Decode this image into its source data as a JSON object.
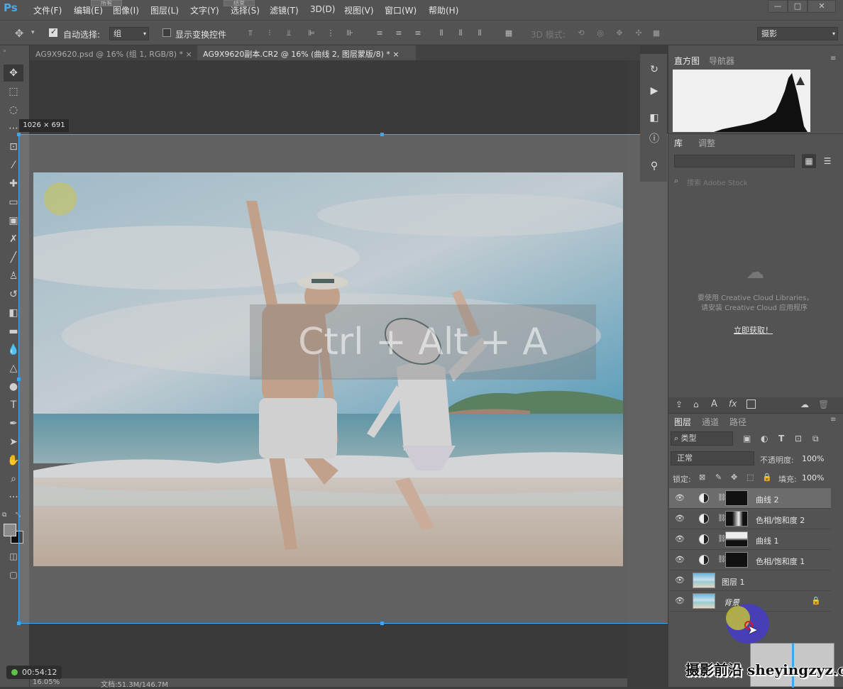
{
  "menubar": {
    "logo": "Ps",
    "items": [
      "文件(F)",
      "编辑(E)",
      "图像(I)",
      "图层(L)",
      "文字(Y)",
      "选择(S)",
      "滤镜(T)",
      "3D(D)",
      "视图(V)",
      "窗口(W)",
      "帮助(H)"
    ],
    "faded_buttons": [
      "所有",
      "",
      "",
      "",
      "结束"
    ]
  },
  "options": {
    "auto_select_label": "自动选择:",
    "auto_select_value": "组",
    "show_transform_label": "显示变换控件",
    "mode_3d": "3D 模式:",
    "workspace": "摄影"
  },
  "tabs": [
    {
      "label": "AG9X9620.psd @ 16% (组 1, RGB/8) *",
      "close": "×"
    },
    {
      "label": "AG9X9620副本.CR2 @ 16% (曲线 2, 图层蒙版/8) *",
      "close": "×"
    }
  ],
  "canvas": {
    "dimensions": "1026 × 691",
    "shortcut": "Ctrl + Alt + A",
    "zoom": "16.05%",
    "doc_size": "文档:51.3M/146.7M"
  },
  "recorder": {
    "time": "00:54:12"
  },
  "histogram_panel": {
    "tabs": [
      "直方图",
      "导航器"
    ]
  },
  "library_panel": {
    "tabs": [
      "库",
      "调整"
    ],
    "search_placeholder": "搜索 Adobe Stock",
    "cc_line1": "要使用 Creative Cloud Libraries，",
    "cc_line2": "请安装 Creative Cloud 应用程序",
    "get_now": "立即获取！"
  },
  "layers_panel": {
    "tabs": [
      "图层",
      "通道",
      "路径"
    ],
    "filter_type": "类型",
    "blend_mode": "正常",
    "opacity_label": "不透明度:",
    "opacity_value": "100%",
    "lock_label": "锁定:",
    "fill_label": "填充:",
    "fill_value": "100%",
    "layers": [
      {
        "name": "曲线 2",
        "selected": true,
        "kind": "adjustment"
      },
      {
        "name": "色相/饱和度 2",
        "selected": false,
        "kind": "adjustment"
      },
      {
        "name": "曲线 1",
        "selected": false,
        "kind": "adjustment"
      },
      {
        "name": "色相/饱和度 1",
        "selected": false,
        "kind": "adjustment"
      },
      {
        "name": "图层 1",
        "selected": false,
        "kind": "pixel"
      },
      {
        "name": "背景",
        "selected": false,
        "kind": "background"
      }
    ]
  },
  "watermark": "摄影前沿 sheyingzyz.com",
  "colors": {
    "accent": "#3ea6f0",
    "panel": "#535353",
    "canvas": "#282828"
  }
}
